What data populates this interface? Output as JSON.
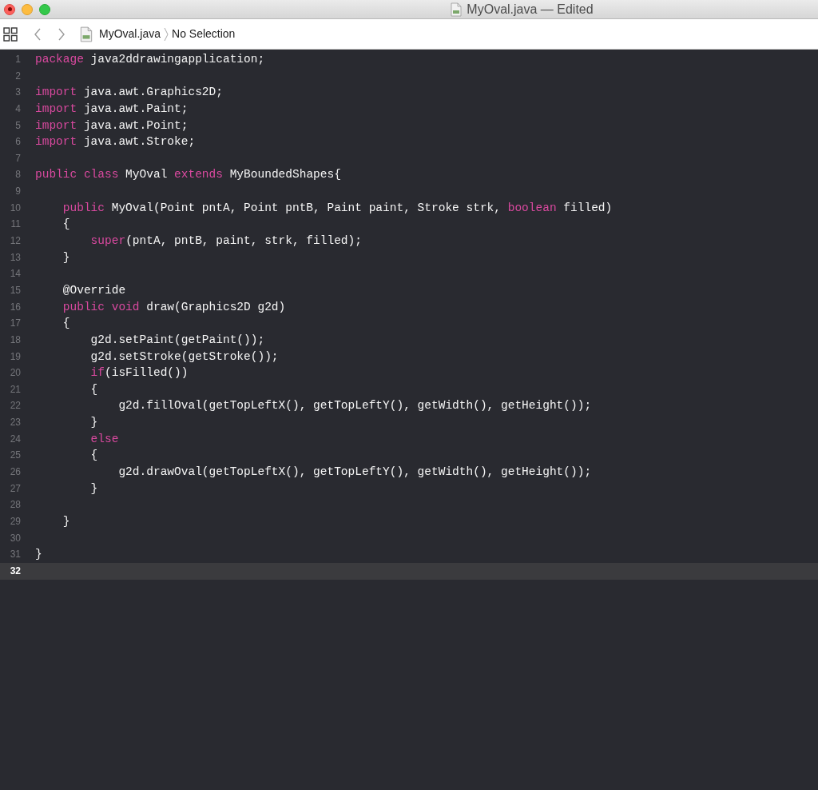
{
  "window": {
    "title": "MyOval.java — Edited"
  },
  "jump_bar": {
    "file": "MyOval.java",
    "location": "No Selection"
  },
  "lines": [
    {
      "number": "1",
      "selected": false,
      "tokens": [
        {
          "kind": "keyword",
          "text": "package"
        },
        {
          "kind": "plain",
          "text": " java2ddrawingapplication;"
        }
      ]
    },
    {
      "number": "2",
      "selected": false
    },
    {
      "number": "3",
      "selected": false,
      "tokens": [
        {
          "kind": "keyword",
          "text": "import"
        },
        {
          "kind": "plain",
          "text": " java.awt.Graphics2D;"
        }
      ]
    },
    {
      "number": "4",
      "selected": false,
      "tokens": [
        {
          "kind": "keyword",
          "text": "import"
        },
        {
          "kind": "plain",
          "text": " java.awt.Paint;"
        }
      ]
    },
    {
      "number": "5",
      "selected": false,
      "tokens": [
        {
          "kind": "keyword",
          "text": "import"
        },
        {
          "kind": "plain",
          "text": " java.awt.Point;"
        }
      ]
    },
    {
      "number": "6",
      "selected": false,
      "tokens": [
        {
          "kind": "keyword",
          "text": "import"
        },
        {
          "kind": "plain",
          "text": " java.awt.Stroke;"
        }
      ]
    },
    {
      "number": "7",
      "selected": false
    },
    {
      "number": "8",
      "selected": false,
      "tokens": [
        {
          "kind": "keyword",
          "text": "public class"
        },
        {
          "kind": "plain",
          "text": " MyOval "
        },
        {
          "kind": "keyword",
          "text": "extends"
        },
        {
          "kind": "plain",
          "text": " MyBoundedShapes{"
        }
      ]
    },
    {
      "number": "9",
      "selected": false
    },
    {
      "number": "10",
      "selected": false,
      "tokens": [
        {
          "kind": "keyword",
          "text": "    public"
        },
        {
          "kind": "plain",
          "text": " MyOval(Point pntA, Point pntB, Paint paint, Stroke strk, "
        },
        {
          "kind": "keyword",
          "text": "boolean"
        },
        {
          "kind": "plain",
          "text": " filled)"
        }
      ]
    },
    {
      "number": "11",
      "selected": false,
      "tokens": [
        {
          "kind": "plain",
          "text": "    {"
        }
      ]
    },
    {
      "number": "12",
      "selected": false,
      "tokens": [
        {
          "kind": "keyword",
          "text": "        super"
        },
        {
          "kind": "plain",
          "text": "(pntA, pntB, paint, strk, filled);"
        }
      ]
    },
    {
      "number": "13",
      "selected": false,
      "tokens": [
        {
          "kind": "plain",
          "text": "    }"
        }
      ]
    },
    {
      "number": "14",
      "selected": false
    },
    {
      "number": "15",
      "selected": false,
      "tokens": [
        {
          "kind": "plain",
          "text": "    @Override"
        }
      ]
    },
    {
      "number": "16",
      "selected": false,
      "tokens": [
        {
          "kind": "keyword",
          "text": "    public void"
        },
        {
          "kind": "plain",
          "text": " draw(Graphics2D g2d)"
        }
      ]
    },
    {
      "number": "17",
      "selected": false,
      "tokens": [
        {
          "kind": "plain",
          "text": "    {"
        }
      ]
    },
    {
      "number": "18",
      "selected": false,
      "tokens": [
        {
          "kind": "plain",
          "text": "        g2d.setPaint(getPaint());"
        }
      ]
    },
    {
      "number": "19",
      "selected": false,
      "tokens": [
        {
          "kind": "plain",
          "text": "        g2d.setStroke(getStroke());"
        }
      ]
    },
    {
      "number": "20",
      "selected": false,
      "tokens": [
        {
          "kind": "keyword",
          "text": "        if"
        },
        {
          "kind": "plain",
          "text": "(isFilled())"
        }
      ]
    },
    {
      "number": "21",
      "selected": false,
      "tokens": [
        {
          "kind": "plain",
          "text": "        {"
        }
      ]
    },
    {
      "number": "22",
      "selected": false,
      "tokens": [
        {
          "kind": "plain",
          "text": "            g2d.fillOval(getTopLeftX(), getTopLeftY(), getWidth(), getHeight());"
        }
      ]
    },
    {
      "number": "23",
      "selected": false,
      "tokens": [
        {
          "kind": "plain",
          "text": "        }"
        }
      ]
    },
    {
      "number": "24",
      "selected": false,
      "tokens": [
        {
          "kind": "keyword",
          "text": "        else"
        }
      ]
    },
    {
      "number": "25",
      "selected": false,
      "tokens": [
        {
          "kind": "plain",
          "text": "        {"
        }
      ]
    },
    {
      "number": "26",
      "selected": false,
      "tokens": [
        {
          "kind": "plain",
          "text": "            g2d.drawOval(getTopLeftX(), getTopLeftY(), getWidth(), getHeight());"
        }
      ]
    },
    {
      "number": "27",
      "selected": false,
      "tokens": [
        {
          "kind": "plain",
          "text": "        }"
        }
      ]
    },
    {
      "number": "28",
      "selected": false
    },
    {
      "number": "29",
      "selected": false,
      "tokens": [
        {
          "kind": "plain",
          "text": "    }"
        }
      ]
    },
    {
      "number": "30",
      "selected": false
    },
    {
      "number": "31",
      "selected": false,
      "tokens": [
        {
          "kind": "plain",
          "text": "}"
        }
      ]
    },
    {
      "number": "32",
      "selected": true
    }
  ]
}
